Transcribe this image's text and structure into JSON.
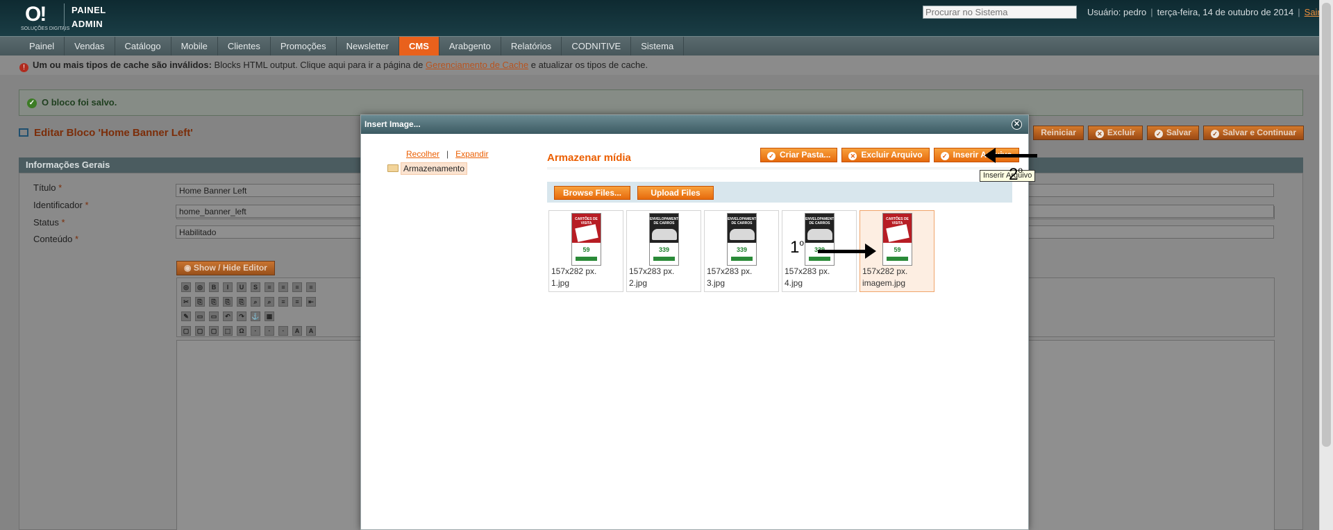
{
  "header": {
    "logo_mark": "O!",
    "logo_sub": "SOLUÇÕES DIGITAIS",
    "brand_line1": "PAINEL",
    "brand_line2": "ADMIN",
    "search_placeholder": "Procurar no Sistema",
    "user_label": "Usuário: pedro",
    "date": "terça-feira, 14 de outubro de 2014",
    "logout": "Sair"
  },
  "nav": [
    "Painel",
    "Vendas",
    "Catálogo",
    "Mobile",
    "Clientes",
    "Promoções",
    "Newsletter",
    "CMS",
    "Arabgento",
    "Relatórios",
    "CODNITIVE",
    "Sistema"
  ],
  "nav_active": "CMS",
  "notice": {
    "bold": "Um ou mais tipos de cache são inválidos:",
    "text1": " Blocks HTML output. Clique aqui para ir a página de ",
    "link": "Gerenciamento de Cache",
    "text2": " e atualizar os tipos de cache."
  },
  "success_message": "O bloco foi salvo.",
  "page_title": "Editar Bloco 'Home Banner Left'",
  "actions": {
    "reset_partial": "ar",
    "reset": "Reiniciar",
    "delete": "Excluir",
    "save": "Salvar",
    "save_continue": "Salvar e Continuar"
  },
  "section_title": "Informações Gerais",
  "form": {
    "title_label": "Título",
    "title_value": "Home Banner Left",
    "id_label": "Identificador",
    "id_value": "home_banner_left",
    "status_label": "Status",
    "status_value": "Habilitado",
    "content_label": "Conteúdo",
    "req": "*",
    "show_hide": "Show / Hide Editor"
  },
  "modal": {
    "title": "Insert Image...",
    "collapse": "Recolher",
    "expand": "Expandir",
    "separator": "|",
    "tree_root": "Armazenamento",
    "media_title": "Armazenar mídia",
    "new_folder": "Criar Pasta...",
    "delete_file": "Excluir Arquivo",
    "insert_file": "Inserir Arquivo",
    "tooltip": "Inserir Arquivo",
    "browse": "Browse Files...",
    "upload": "Upload Files",
    "files": [
      {
        "dim": "157x282 px.",
        "name": "1.jpg",
        "style": "red",
        "top": "CARTÕES DE VISITA",
        "price": "59"
      },
      {
        "dim": "157x283 px.",
        "name": "2.jpg",
        "style": "car",
        "top": "ENVELOPAMENTO DE CARROS",
        "price": "339"
      },
      {
        "dim": "157x283 px.",
        "name": "3.jpg",
        "style": "car",
        "top": "ENVELOPAMENTO DE CARROS",
        "price": "339"
      },
      {
        "dim": "157x283 px.",
        "name": "4.jpg",
        "style": "car",
        "top": "ENVELOPAMENTO DE CARROS",
        "price": "339"
      },
      {
        "dim": "157x282 px.",
        "name": "imagem.jpg",
        "style": "red",
        "top": "CARTÕES DE VISITA",
        "price": "59",
        "selected": true
      }
    ]
  },
  "annotations": {
    "step1": "1",
    "step2": "2",
    "ordinal": "o"
  }
}
